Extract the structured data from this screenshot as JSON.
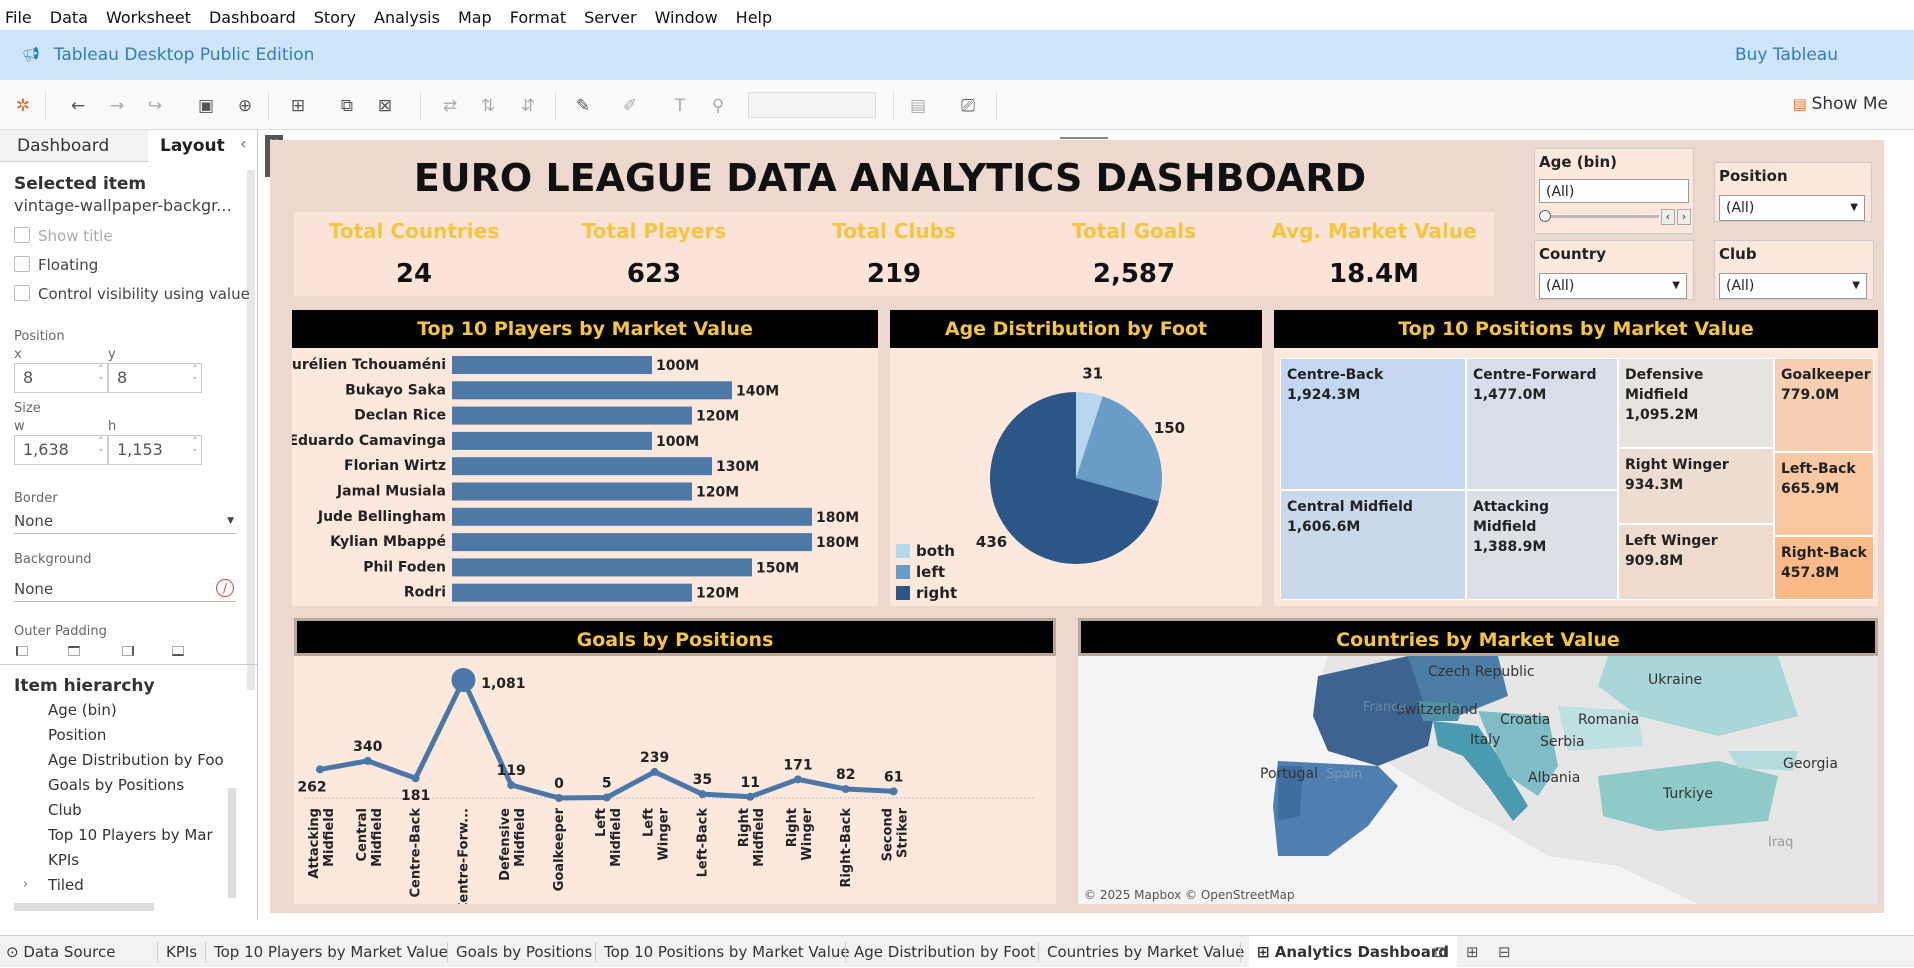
{
  "menu": [
    "File",
    "Data",
    "Worksheet",
    "Dashboard",
    "Story",
    "Analysis",
    "Map",
    "Format",
    "Server",
    "Window",
    "Help"
  ],
  "banner": {
    "edition": "Tableau Desktop Public Edition",
    "buy": "Buy Tableau"
  },
  "toolbar": {
    "show_me": "Show Me"
  },
  "left_panel": {
    "tabs": [
      "Dashboard",
      "Layout"
    ],
    "selected_item_title": "Selected item",
    "selected_item_name": "vintage-wallpaper-backgr...",
    "checkboxes": [
      "Show title",
      "Floating",
      "Control visibility using value"
    ],
    "position_label": "Position",
    "x_label": "x",
    "y_label": "y",
    "x_value": "8",
    "y_value": "8",
    "size_label": "Size",
    "w_label": "w",
    "h_label": "h",
    "w_value": "1,638",
    "h_value": "1,153",
    "border_label": "Border",
    "border_value": "None",
    "background_label": "Background",
    "background_value": "None",
    "outer_padding_label": "Outer Padding",
    "hierarchy_title": "Item hierarchy",
    "hierarchy": [
      {
        "label": "Age  (bin)",
        "icon": "filter-icon"
      },
      {
        "label": "Position",
        "icon": "filter-icon"
      },
      {
        "label": "Age Distribution by Foo",
        "icon": "sheet-icon"
      },
      {
        "label": "Goals by Positions",
        "icon": "sheet-icon"
      },
      {
        "label": "Club",
        "icon": "filter-icon"
      },
      {
        "label": "Top 10 Players by Mar",
        "icon": "sheet-icon"
      },
      {
        "label": "KPIs",
        "icon": "sheet-icon"
      },
      {
        "label": "Tiled",
        "icon": "container-icon"
      }
    ]
  },
  "dashboard": {
    "title": "EURO LEAGUE DATA ANALYTICS DASHBOARD",
    "kpis": [
      {
        "label": "Total Countries",
        "value": "24"
      },
      {
        "label": "Total Players",
        "value": "623"
      },
      {
        "label": "Total Clubs",
        "value": "219"
      },
      {
        "label": "Total Goals",
        "value": "2,587"
      },
      {
        "label": "Avg. Market Value",
        "value": "18.4M"
      }
    ],
    "filters": {
      "age": {
        "title": "Age  (bin)",
        "value": "(All)"
      },
      "position": {
        "title": "Position",
        "value": "(All)"
      },
      "country": {
        "title": "Country",
        "value": "(All)"
      },
      "club": {
        "title": "Club",
        "value": "(All)"
      }
    },
    "players_title": "Top 10 Players by Market Value",
    "foot_title": "Age Distribution by Foot",
    "positions_title": "Top 10 Positions by Market Value",
    "goals_title": "Goals by Positions",
    "map_title": "Countries by Market Value",
    "map_credit": "© 2025 Mapbox © OpenStreetMap",
    "map_labels": [
      "Czech Republic",
      "Ukraine",
      "Switzerland",
      "Croatia",
      "Romania",
      "Italy",
      "Serbia",
      "Portugal",
      "Spain",
      "Albania",
      "Georgia",
      "Turkiye",
      "Iraq",
      "France"
    ],
    "treemap": [
      {
        "name": "Centre-Back",
        "value": "1,924.3M"
      },
      {
        "name": "Centre-Forward",
        "value": "1,477.0M"
      },
      {
        "name": "Defensive Midfield",
        "value": "1,095.2M"
      },
      {
        "name": "Goalkeeper",
        "value": "779.0M"
      },
      {
        "name": "Central Midfield",
        "value": "1,606.6M"
      },
      {
        "name": "Attacking Midfield",
        "value": "1,388.9M"
      },
      {
        "name": "Right Winger",
        "value": "934.3M"
      },
      {
        "name": "Left-Back",
        "value": "665.9M"
      },
      {
        "name": "Left Winger",
        "value": "909.8M"
      },
      {
        "name": "Right-Back",
        "value": "457.8M"
      }
    ],
    "colors": {
      "bar": "#4e79a7",
      "pie_both": "#b5d8ee",
      "pie_left": "#6a9cc8",
      "pie_right": "#2b5685",
      "line": "#4b76a8"
    }
  },
  "chart_data": [
    {
      "type": "bar",
      "orientation": "horizontal",
      "title": "Top 10 Players by Market Value",
      "categories": [
        "Aurélien Tchouaméni",
        "Bukayo Saka",
        "Declan Rice",
        "Eduardo Camavinga",
        "Florian Wirtz",
        "Jamal Musiala",
        "Jude Bellingham",
        "Kylian Mbappé",
        "Phil Foden",
        "Rodri"
      ],
      "values": [
        100,
        140,
        120,
        100,
        130,
        120,
        180,
        180,
        150,
        120
      ],
      "labels": [
        "100M",
        "140M",
        "120M",
        "100M",
        "130M",
        "120M",
        "180M",
        "180M",
        "150M",
        "120M"
      ],
      "unit": "M"
    },
    {
      "type": "pie",
      "title": "Age Distribution by Foot",
      "categories": [
        "both",
        "left",
        "right"
      ],
      "values": [
        31,
        150,
        436
      ],
      "labels": [
        "31",
        "150",
        "436"
      ]
    },
    {
      "type": "line",
      "title": "Goals by Positions",
      "categories": [
        "Attacking Midfield",
        "Central Midfield",
        "Centre-Back",
        "Centre-Forw...",
        "Defensive Midfield",
        "Goalkeeper",
        "Left Midfield",
        "Left Winger",
        "Left-Back",
        "Right Midfield",
        "Right Winger",
        "Right-Back",
        "Second Striker"
      ],
      "values": [
        262,
        340,
        181,
        1081,
        119,
        0,
        5,
        239,
        35,
        11,
        171,
        82,
        61
      ],
      "labels": [
        "262",
        "340",
        "181",
        "1,081",
        "119",
        "0",
        "5",
        "239",
        "35",
        "11",
        "171",
        "82",
        "61"
      ]
    }
  ],
  "bottom_tabs": [
    "Data Source",
    "KPIs",
    "Top 10 Players by Market Value",
    "Goals by Positions",
    "Top 10 Positions by Market Value",
    "Age Distribution by Foot",
    "Countries by Market Value",
    "Analytics Dashboard"
  ]
}
